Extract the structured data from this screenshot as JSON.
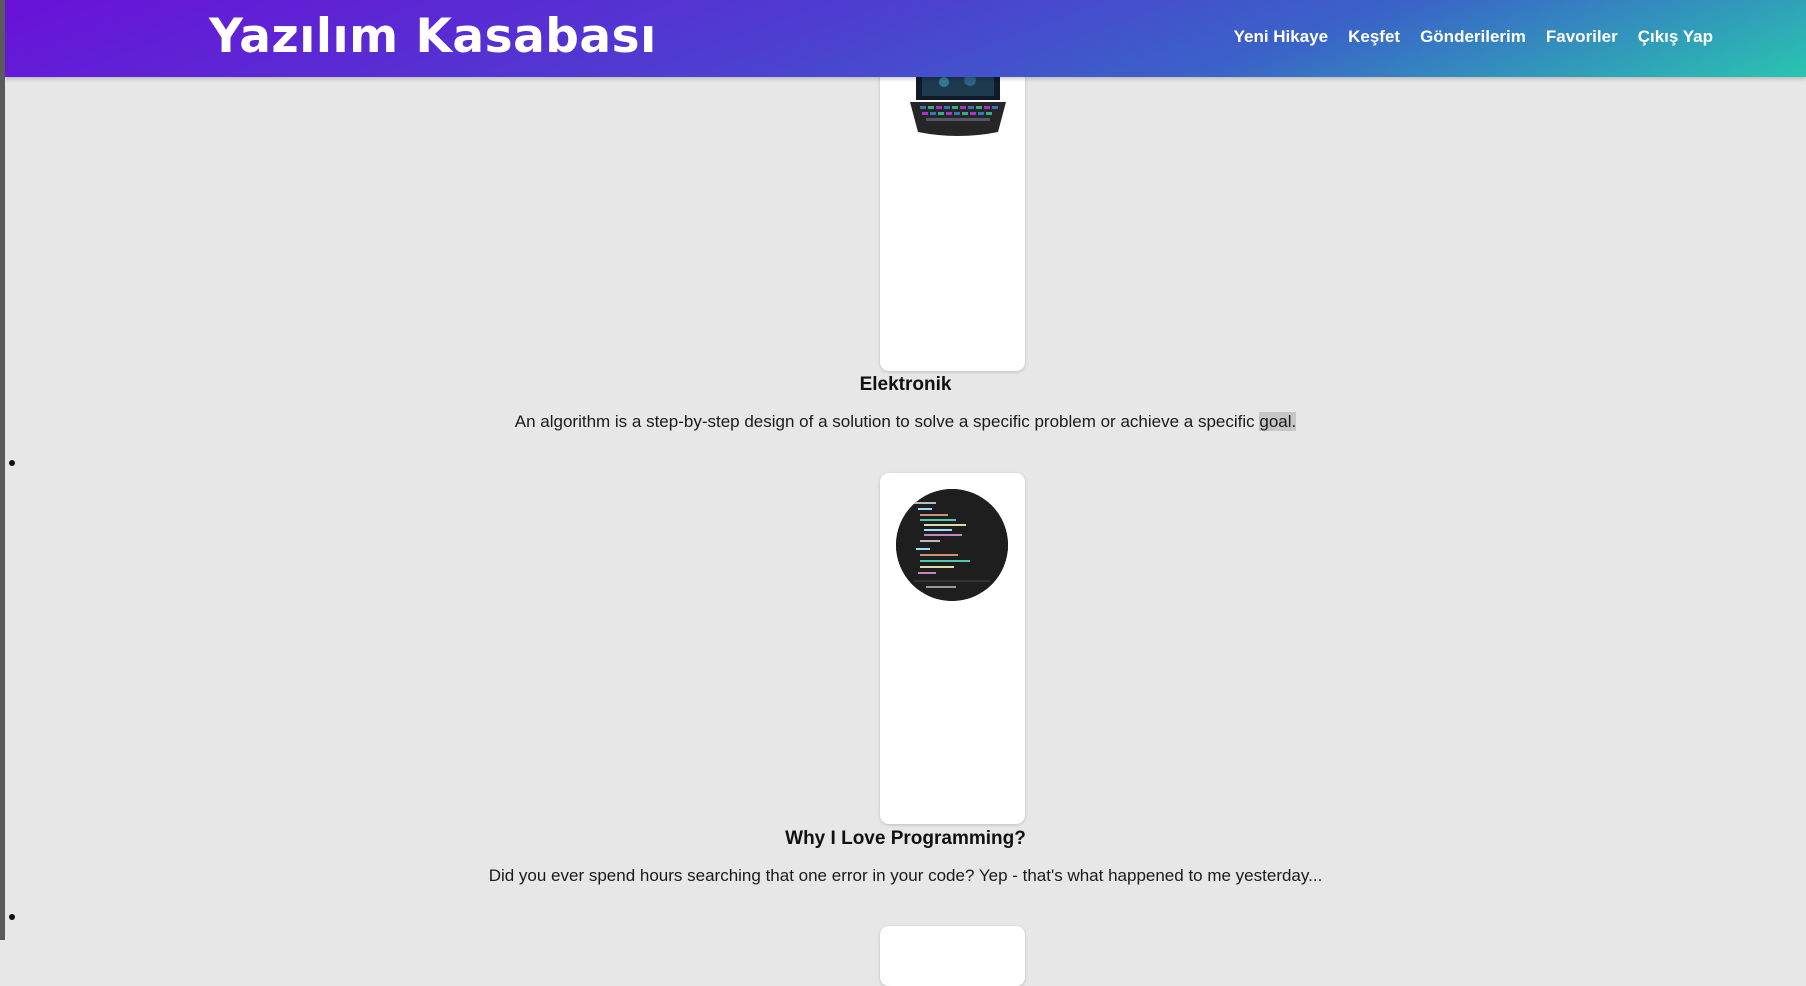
{
  "header": {
    "logo": "Yazılım Kasabası",
    "nav": [
      "Yeni Hikaye",
      "Keşfet",
      "Gönderilerim",
      "Favoriler",
      "Çıkış Yap"
    ]
  },
  "stories": [
    {
      "title": "Elektronik",
      "excerpt_main": "An algorithm is a step-by-step design of a solution to solve a specific problem or achieve a specific",
      "excerpt_highlight": "goal.",
      "image": "laptop-image"
    },
    {
      "title": "Why I Love Programming?",
      "excerpt_main": "Did you ever spend hours searching that one error in your code? Yep - that's what happened to me yesterday...",
      "image": "code-screen-image"
    }
  ],
  "colors": {
    "header_gradient_start": "#6a11d8",
    "header_gradient_end": "#2ac4b0",
    "page_background": "#e7e7e7",
    "card_background": "#ffffff"
  }
}
